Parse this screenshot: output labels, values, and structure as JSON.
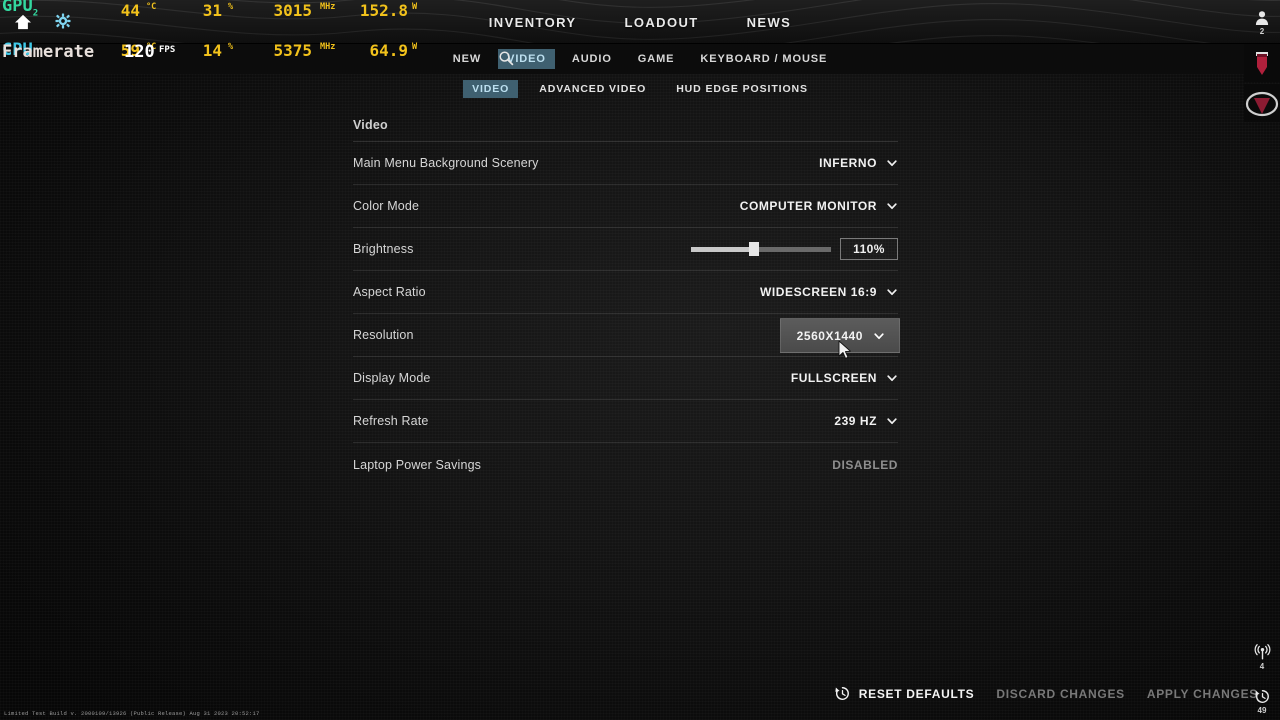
{
  "header": {
    "nav": [
      {
        "label": "INVENTORY",
        "name": "nav-inventory"
      },
      {
        "label": "LOADOUT",
        "name": "nav-loadout"
      },
      {
        "label": "NEWS",
        "name": "nav-news"
      }
    ]
  },
  "settings_tabs": {
    "search_icon": "search-icon",
    "items": [
      {
        "label": "NEW",
        "active": false
      },
      {
        "label": "VIDEO",
        "active": true
      },
      {
        "label": "AUDIO",
        "active": false
      },
      {
        "label": "GAME",
        "active": false
      },
      {
        "label": "KEYBOARD / MOUSE",
        "active": false
      }
    ]
  },
  "settings_subtabs": {
    "items": [
      {
        "label": "VIDEO",
        "active": true
      },
      {
        "label": "ADVANCED VIDEO",
        "active": false
      },
      {
        "label": "HUD EDGE POSITIONS",
        "active": false
      }
    ]
  },
  "panel": {
    "title": "Video",
    "rows": [
      {
        "label": "Main Menu Background Scenery",
        "value": "INFERNO",
        "control": "dropdown",
        "name": "main-menu-background-scenery"
      },
      {
        "label": "Color Mode",
        "value": "COMPUTER MONITOR",
        "control": "dropdown",
        "name": "color-mode"
      },
      {
        "label": "Brightness",
        "value": "110%",
        "control": "slider",
        "slider_percent": 45,
        "name": "brightness"
      },
      {
        "label": "Aspect Ratio",
        "value": "WIDESCREEN 16:9",
        "control": "dropdown",
        "name": "aspect-ratio"
      },
      {
        "label": "Resolution",
        "value": "2560X1440",
        "control": "dropdown-hovered",
        "name": "resolution"
      },
      {
        "label": "Display Mode",
        "value": "FULLSCREEN",
        "control": "dropdown",
        "name": "display-mode"
      },
      {
        "label": "Refresh Rate",
        "value": "239 HZ",
        "control": "dropdown",
        "name": "refresh-rate"
      },
      {
        "label": "Laptop Power Savings",
        "value": "DISABLED",
        "control": "static",
        "name": "laptop-power-savings"
      }
    ]
  },
  "footer": {
    "reset_defaults": "RESET DEFAULTS",
    "discard_changes": "DISCARD CHANGES",
    "apply_changes": "APPLY CHANGES",
    "build_string": "Limited Test Build v. 2000109/13926 (Public Release) Aug 31 2023 20:52:17"
  },
  "hwmon": {
    "gpu": {
      "name": "GPU",
      "index": "2",
      "temp": "44",
      "temp_unit": "°C",
      "usage": "31",
      "usage_unit": "%",
      "clock": "3015",
      "clock_unit": "MHz",
      "power": "152.8",
      "power_unit": "W"
    },
    "cpu": {
      "name": "CPU",
      "temp": "59",
      "temp_unit": "°C",
      "usage": "14",
      "usage_unit": "%",
      "clock": "5375",
      "clock_unit": "MHz",
      "power": "64.9",
      "power_unit": "W"
    },
    "framerate": {
      "label": "Framerate",
      "value": "120",
      "unit": "FPS"
    },
    "colors": {
      "gpu": "#33d9a0",
      "cpu": "#3fc9e8",
      "numbers": "#f2c21b",
      "framerate_label": "#e8e0dc"
    }
  },
  "right_rail": {
    "friends_count": "2",
    "broadcast_count": "4",
    "history_count": "49"
  },
  "colors": {
    "accent_tab": "#3f6070",
    "accent_tab_text": "#bde0f0",
    "panel_text": "#d6d6d6",
    "value_text": "#f2f2f2",
    "muted_text": "#8e8e8e"
  }
}
